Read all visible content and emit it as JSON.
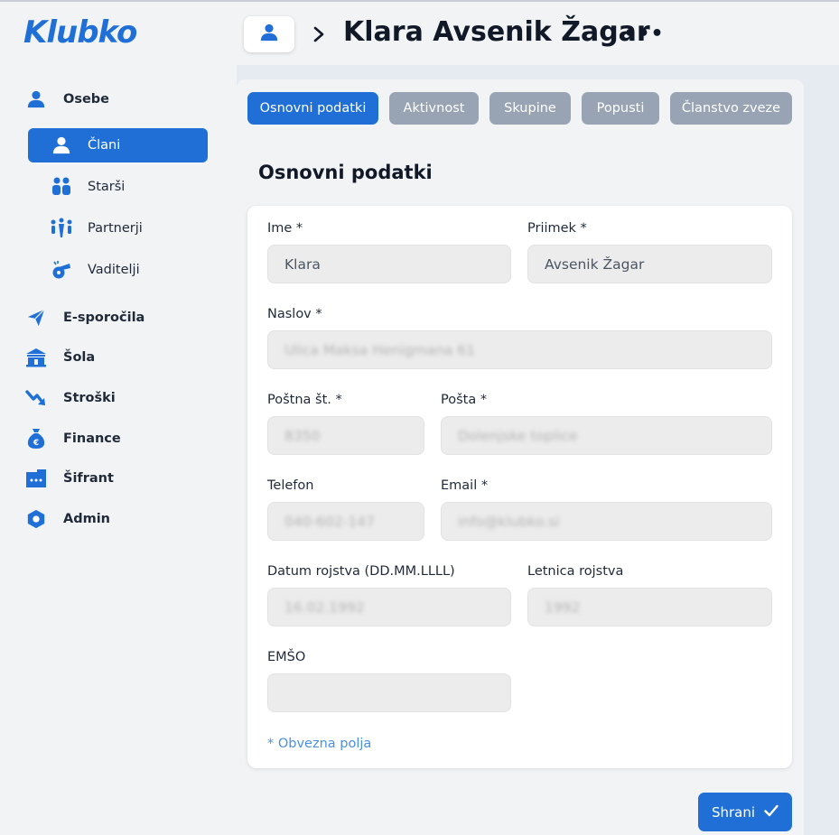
{
  "app": {
    "logo": "Klubko"
  },
  "header": {
    "title": "Klara Avsenik Žagar",
    "more": "•••"
  },
  "sidebar": {
    "items": [
      {
        "label": "Osebe",
        "icon": "user-icon"
      },
      {
        "label": "E-sporočila",
        "icon": "send-icon"
      },
      {
        "label": "Šola",
        "icon": "school-icon"
      },
      {
        "label": "Stroški",
        "icon": "trend-down-icon"
      },
      {
        "label": "Finance",
        "icon": "money-bag-icon"
      },
      {
        "label": "Šifrant",
        "icon": "codebook-icon"
      },
      {
        "label": "Admin",
        "icon": "shield-icon"
      }
    ],
    "sub_items": [
      {
        "label": "Člani",
        "icon": "member-icon",
        "active": true
      },
      {
        "label": "Starši",
        "icon": "parents-icon",
        "active": false
      },
      {
        "label": "Partnerji",
        "icon": "partners-icon",
        "active": false
      },
      {
        "label": "Vaditelji",
        "icon": "whistle-icon",
        "active": false
      }
    ]
  },
  "tabs": [
    {
      "label": "Osnovni podatki",
      "active": true
    },
    {
      "label": "Aktivnost",
      "active": false
    },
    {
      "label": "Skupine",
      "active": false
    },
    {
      "label": "Popusti",
      "active": false
    },
    {
      "label": "Članstvo zveze",
      "active": false
    }
  ],
  "section": {
    "title": "Osnovni podatki"
  },
  "form": {
    "ime": {
      "label": "Ime *",
      "value": "Klara"
    },
    "priimek": {
      "label": "Priimek *",
      "value": "Avsenik Žagar"
    },
    "naslov": {
      "label": "Naslov *",
      "value": "Ulica Maksa Henigmana 61"
    },
    "postna_st": {
      "label": "Poštna št. *",
      "value": "8350"
    },
    "posta": {
      "label": "Pošta *",
      "value": "Dolenjske toplice"
    },
    "telefon": {
      "label": "Telefon",
      "value": "040-602-147"
    },
    "email": {
      "label": "Email *",
      "value": "info@klubko.si"
    },
    "datum_rojstva": {
      "label": "Datum rojstva (DD.MM.LLLL)",
      "value": "16.02.1992"
    },
    "letnica_rojstva": {
      "label": "Letnica rojstva",
      "value": "1992"
    },
    "emso": {
      "label": "EMŠO",
      "value": ""
    },
    "required_note": "* Obvezna polja"
  },
  "actions": {
    "save_label": "Shrani"
  },
  "colors": {
    "primary": "#1f6fd6",
    "tab_inactive": "#98a4b3",
    "note": "#4a90e2"
  }
}
